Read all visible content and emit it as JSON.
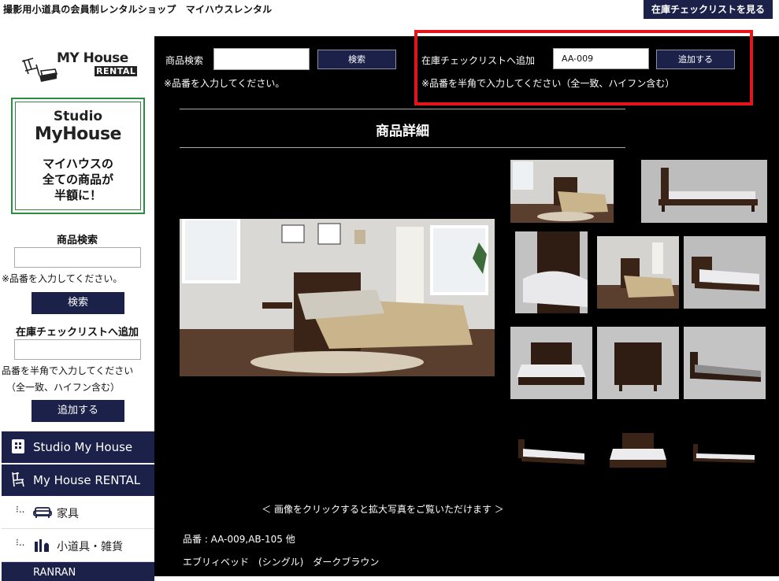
{
  "topbar": {
    "tagline": "撮影用小道具の会員制レンタルショップ　マイハウスレンタル",
    "checklist_link": "在庫チェックリストを見る"
  },
  "sidebar": {
    "logo": {
      "main": "MY House",
      "sub": "RENTAL"
    },
    "banner": {
      "line1": "Studio",
      "line2": "MyHouse",
      "line3": "マイハウスの",
      "line4": "全ての商品が",
      "line5": "半額に！"
    },
    "search_heading": "商品検索",
    "search_note": "※品番を入力してください。",
    "search_button": "検索",
    "stock_heading": "在庫チェックリストへ追加",
    "stock_note1": "品番を半角で入力してください",
    "stock_note2": "（全一致、ハイフン含む）",
    "stock_button": "追加する",
    "nav": [
      {
        "label": "Studio My House",
        "icon": "building-icon"
      },
      {
        "label": "My House RENTAL",
        "icon": "chair-icon"
      }
    ],
    "sub_nav": [
      {
        "label": "家具",
        "icon": "sofa-icon"
      },
      {
        "label": "小道具・雑貨",
        "icon": "props-icon"
      }
    ],
    "nav_partial": "RANRAN"
  },
  "main": {
    "search_label": "商品検索",
    "search_value": "",
    "search_button": "検索",
    "search_note": "※品番を入力してください。",
    "stock_label": "在庫チェックリストへ追加",
    "stock_value": "AA-009",
    "stock_button": "追加する",
    "stock_note": "※品番を半角で入力してください（全一致、ハイフン含む）",
    "detail_title": "商品詳細",
    "click_note": "＜ 画像をクリックすると拡大写真をご覧いただけます ＞",
    "item_code": "品番 : AA-009,AB-105 他",
    "item_name": "エブリィベッド　(シングル)　ダークブラウン"
  },
  "colors": {
    "navy": "#1b2148",
    "highlight": "#e3141b",
    "banner_green": "#2e8b44"
  }
}
